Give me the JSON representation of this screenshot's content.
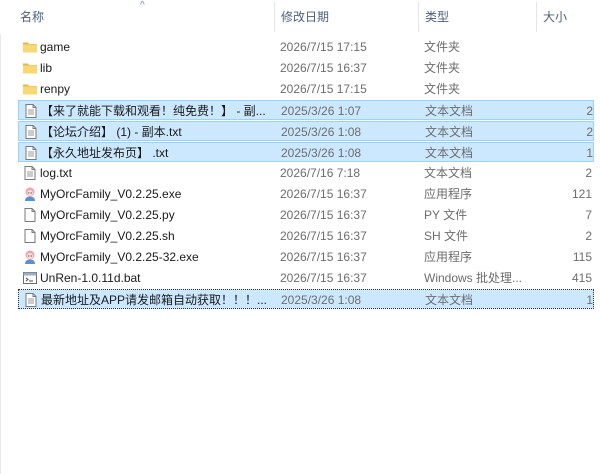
{
  "header": {
    "name": "名称",
    "date": "修改日期",
    "type": "类型",
    "size": "大小",
    "sort_arrow": "^"
  },
  "rows": [
    {
      "name": "game",
      "date": "2026/7/15 17:15",
      "type": "文件夹",
      "size": "",
      "icon": "folder-icon",
      "state": "normal"
    },
    {
      "name": "lib",
      "date": "2026/7/15 16:37",
      "type": "文件夹",
      "size": "",
      "icon": "folder-icon",
      "state": "normal"
    },
    {
      "name": "renpy",
      "date": "2026/7/15 17:15",
      "type": "文件夹",
      "size": "",
      "icon": "folder-icon",
      "state": "normal"
    },
    {
      "name": "【来了就能下载和观看！纯免费！】 - 副...",
      "date": "2025/3/26 1:07",
      "type": "文本文档",
      "size": "2",
      "icon": "text-file-icon",
      "state": "selected"
    },
    {
      "name": "【论坛介绍】 (1) - 副本.txt",
      "date": "2025/3/26 1:08",
      "type": "文本文档",
      "size": "2",
      "icon": "text-file-icon",
      "state": "selected"
    },
    {
      "name": "【永久地址发布页】 .txt",
      "date": "2025/3/26 1:08",
      "type": "文本文档",
      "size": "1",
      "icon": "text-file-icon",
      "state": "selected"
    },
    {
      "name": "log.txt",
      "date": "2026/7/16 7:18",
      "type": "文本文档",
      "size": "2",
      "icon": "text-file-icon",
      "state": "normal"
    },
    {
      "name": "MyOrcFamily_V0.2.25.exe",
      "date": "2026/7/15 16:37",
      "type": "应用程序",
      "size": "121",
      "icon": "app-exe-icon",
      "state": "normal"
    },
    {
      "name": "MyOrcFamily_V0.2.25.py",
      "date": "2026/7/15 16:37",
      "type": "PY 文件",
      "size": "7",
      "icon": "blank-file-icon",
      "state": "normal"
    },
    {
      "name": "MyOrcFamily_V0.2.25.sh",
      "date": "2026/7/15 16:37",
      "type": "SH 文件",
      "size": "2",
      "icon": "blank-file-icon",
      "state": "normal"
    },
    {
      "name": "MyOrcFamily_V0.2.25-32.exe",
      "date": "2026/7/15 16:37",
      "type": "应用程序",
      "size": "115",
      "icon": "app-exe-icon",
      "state": "normal"
    },
    {
      "name": "UnRen-1.0.11d.bat",
      "date": "2026/7/15 16:37",
      "type": "Windows 批处理...",
      "size": "415",
      "icon": "bat-file-icon",
      "state": "normal"
    },
    {
      "name": "最新地址及APP请发邮箱自动获取！！！...",
      "date": "2025/3/26 1:08",
      "type": "文本文档",
      "size": "1",
      "icon": "text-file-icon",
      "state": "focus"
    }
  ],
  "colors": {
    "selected_bg": "#cce8ff",
    "selected_border": "#99d1ff",
    "folder": "#f8d775",
    "header_text": "#4c607a"
  }
}
